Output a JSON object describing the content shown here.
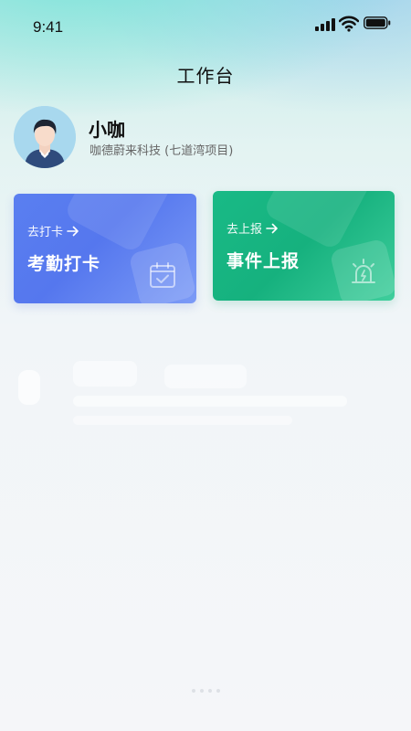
{
  "status_bar": {
    "time": "9:41"
  },
  "header": {
    "title": "工作台"
  },
  "profile": {
    "name": "小咖",
    "company": "咖德蔚来科技 (七道湾项目)"
  },
  "cards": [
    {
      "link_label": "去打卡",
      "title": "考勤打卡",
      "icon": "calendar-check-icon",
      "color": "#5577ee"
    },
    {
      "link_label": "去上报",
      "title": "事件上报",
      "icon": "alarm-light-icon",
      "color": "#16b17e"
    }
  ],
  "colors": {
    "accent_blue": "#5577ee",
    "accent_green": "#16b17e"
  }
}
